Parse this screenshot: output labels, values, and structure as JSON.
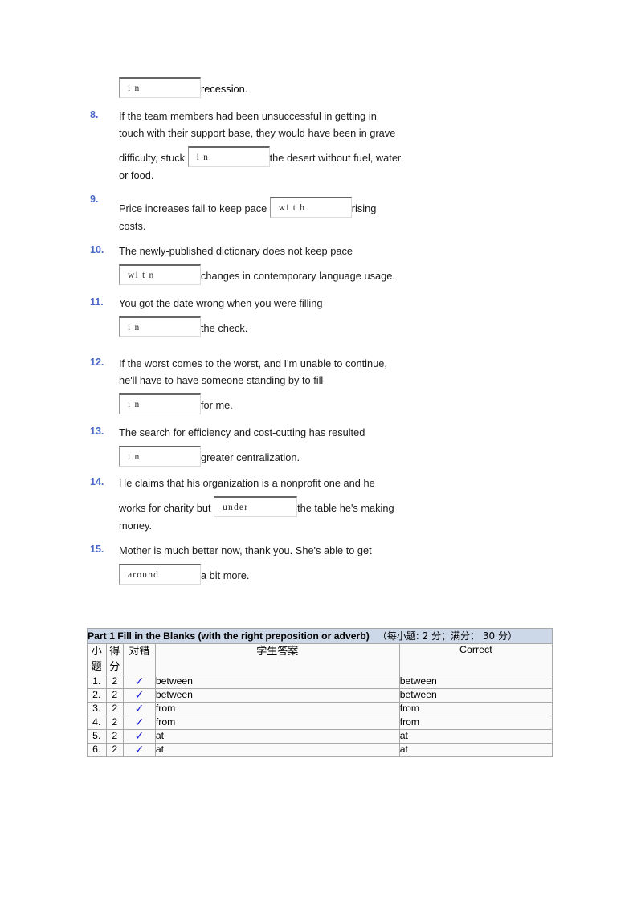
{
  "continuation": {
    "answer": "i n",
    "tail": "recession."
  },
  "questions": [
    {
      "num": "8.",
      "lines": [
        {
          "type": "text",
          "value": "If the team members had been unsuccessful in getting in"
        },
        {
          "type": "text",
          "value": "touch with their support base, they would have been in grave"
        },
        {
          "type": "mixed",
          "before": "difficulty, stuck",
          "answer": "i n",
          "after": "the desert without fuel, water"
        },
        {
          "type": "text",
          "value": "or food."
        }
      ]
    },
    {
      "num": "9.",
      "lines": [
        {
          "type": "mixed",
          "before": "Price increases fail to keep pace",
          "answer": "wi t h",
          "after": "rising"
        },
        {
          "type": "text",
          "value": "costs."
        }
      ]
    },
    {
      "num": "10.",
      "lines": [
        {
          "type": "text",
          "value": "The newly-published dictionary does not keep pace"
        },
        {
          "type": "mixed",
          "before": "",
          "answer": "wi t n",
          "after": "changes in contemporary language usage."
        }
      ]
    },
    {
      "num": "11.",
      "lines": [
        {
          "type": "text",
          "value": "You got the date wrong when you were filling"
        },
        {
          "type": "mixed",
          "before": "",
          "answer": "i n",
          "after": "the check."
        }
      ]
    },
    {
      "num": "12.",
      "lines": [
        {
          "type": "text",
          "value": "If the worst comes to the worst, and I'm unable to continue,"
        },
        {
          "type": "text",
          "value": "he'll have to have someone standing by to fill"
        },
        {
          "type": "mixed",
          "before": "",
          "answer": "i n",
          "after": "for me."
        }
      ]
    },
    {
      "num": "13.",
      "lines": [
        {
          "type": "text",
          "value": "The search for efficiency and cost-cutting has resulted"
        },
        {
          "type": "mixed",
          "before": "",
          "answer": "i n",
          "after": "greater centralization."
        }
      ]
    },
    {
      "num": "14.",
      "lines": [
        {
          "type": "text",
          "value": "He claims that his organization is a nonprofit one and he"
        },
        {
          "type": "mixed",
          "before": "works for charity but",
          "answer": "under",
          "after": "the table he's making"
        },
        {
          "type": "text",
          "value": "money."
        }
      ]
    },
    {
      "num": "15.",
      "lines": [
        {
          "type": "text",
          "value": "Mother is much better now, thank you. She's able to get"
        },
        {
          "type": "mixed",
          "before": "",
          "answer": "around",
          "after": "a bit more."
        }
      ]
    }
  ],
  "result_table": {
    "title_main": "Part 1 Fill in the Blanks (with the right preposition or adverb)",
    "title_cn": "（每小题: 2 分；满分： 30 分）",
    "headers": {
      "item": "小题",
      "score": "得分",
      "mark": "对错",
      "student_answer": "学生答案",
      "correct": "Correct"
    },
    "mark_symbol": "✓",
    "rows": [
      {
        "num": "1.",
        "score": "2",
        "mark": "✓",
        "student": "between",
        "correct": "between"
      },
      {
        "num": "2.",
        "score": "2",
        "mark": "✓",
        "student": "between",
        "correct": "between"
      },
      {
        "num": "3.",
        "score": "2",
        "mark": "✓",
        "student": "from",
        "correct": "from"
      },
      {
        "num": "4.",
        "score": "2",
        "mark": "✓",
        "student": "from",
        "correct": "from"
      },
      {
        "num": "5.",
        "score": "2",
        "mark": "✓",
        "student": "at",
        "correct": "at"
      },
      {
        "num": "6.",
        "score": "2",
        "mark": "✓",
        "student": "at",
        "correct": "at"
      }
    ]
  },
  "colors": {
    "question_number": "#4a68c8",
    "table_header_bg": "#ccd7e8",
    "checkmark": "#1414dc",
    "cell_bg": "#fafafa",
    "border": "#a8a8a8"
  }
}
